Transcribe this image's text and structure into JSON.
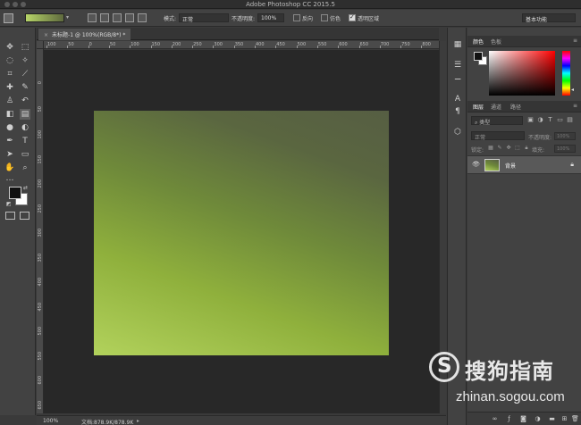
{
  "window": {
    "title": "Adobe Photoshop CC 2015.5"
  },
  "options_bar": {
    "mode_label": "模式:",
    "mode_value": "正常",
    "opacity_label": "不透明度:",
    "opacity_value": "100%",
    "reverse_label": "反向",
    "reverse_checked": false,
    "dither_label": "仿色",
    "dither_checked": false,
    "transparency_label": "透明区域",
    "transparency_checked": true,
    "workspace_value": "基本功能"
  },
  "document": {
    "tab_label": "未标题-1 @ 100%(RGB/8*) *",
    "close_glyph": "×",
    "ruler_top_ticks": [
      "100",
      "50",
      "0",
      "50",
      "100",
      "150",
      "200",
      "250",
      "300",
      "350",
      "400",
      "450",
      "500",
      "550",
      "600",
      "650",
      "700",
      "750",
      "800"
    ],
    "ruler_left_ticks": [
      "0",
      "50",
      "100",
      "150",
      "200",
      "250",
      "300",
      "350",
      "400",
      "450",
      "500",
      "550",
      "600",
      "650"
    ]
  },
  "status_bar": {
    "zoom": "100%",
    "doc_info": "文档:878.9K/878.9K",
    "arrow": "▸"
  },
  "color_panel": {
    "tab_color": "颜色",
    "tab_swatches": "色板",
    "fg_color": "#111111",
    "bg_color": "#ffffff",
    "field_hue": "#ff0000"
  },
  "layers_panel": {
    "tab_layers": "图层",
    "tab_channels": "通道",
    "tab_paths": "路径",
    "filter_label": "类型",
    "blend_mode": "正常",
    "opacity_label": "不透明度:",
    "opacity_value": "100%",
    "lock_label": "锁定:",
    "fill_label": "填充:",
    "fill_value": "100%",
    "layers": [
      {
        "name": "背景",
        "visible": true,
        "locked": true
      }
    ]
  },
  "watermark": {
    "logo_letter": "S",
    "brand": "搜狗指南",
    "url": "zhinan.sogou.com"
  },
  "colors": {
    "gradient_start": "#b2d25c",
    "gradient_end": "#565e43",
    "ui_bg": "#424242",
    "workspace_bg": "#282828"
  }
}
